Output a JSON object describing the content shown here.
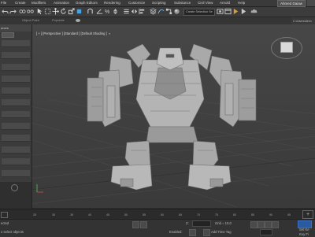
{
  "menu": {
    "items": [
      "File",
      "Edit",
      "Tools",
      "Group",
      "Views",
      "Create",
      "Modifiers",
      "Animation",
      "Graph Editors",
      "Rendering",
      "Customize",
      "Scripting",
      "Substance",
      "Civil View",
      "Arnold",
      "Help"
    ],
    "user": "Ahmed Daiaw"
  },
  "toolbar": {
    "selection_set_placeholder": "Create Selection Se",
    "colors": {
      "accent": "#2a5aa0"
    }
  },
  "subbar": {
    "labels": [
      "Object Paint",
      "Populate"
    ],
    "right_label": "C:\\Users\\Ahm"
  },
  "left_panel": {
    "header": "urces",
    "rows": 12
  },
  "viewport": {
    "label": "[ + ] [Perspective ] [Standard ] [Default Shading ]",
    "filter_icon": "filter-icon"
  },
  "timeline": {
    "ticks": [
      "25",
      "30",
      "35",
      "40",
      "45",
      "50",
      "55",
      "60",
      "65",
      "70",
      "75",
      "80",
      "85",
      "90",
      "95",
      "100"
    ]
  },
  "status": {
    "selected": "ected",
    "prompt": "o select objects",
    "z_label": "Z:",
    "grid": "Grid = 10,0",
    "add_time_tag": "Add Time Tag",
    "enabled_label": "Enabled:",
    "set_key": "Set Ke",
    "key_filters": "Key Fi"
  }
}
